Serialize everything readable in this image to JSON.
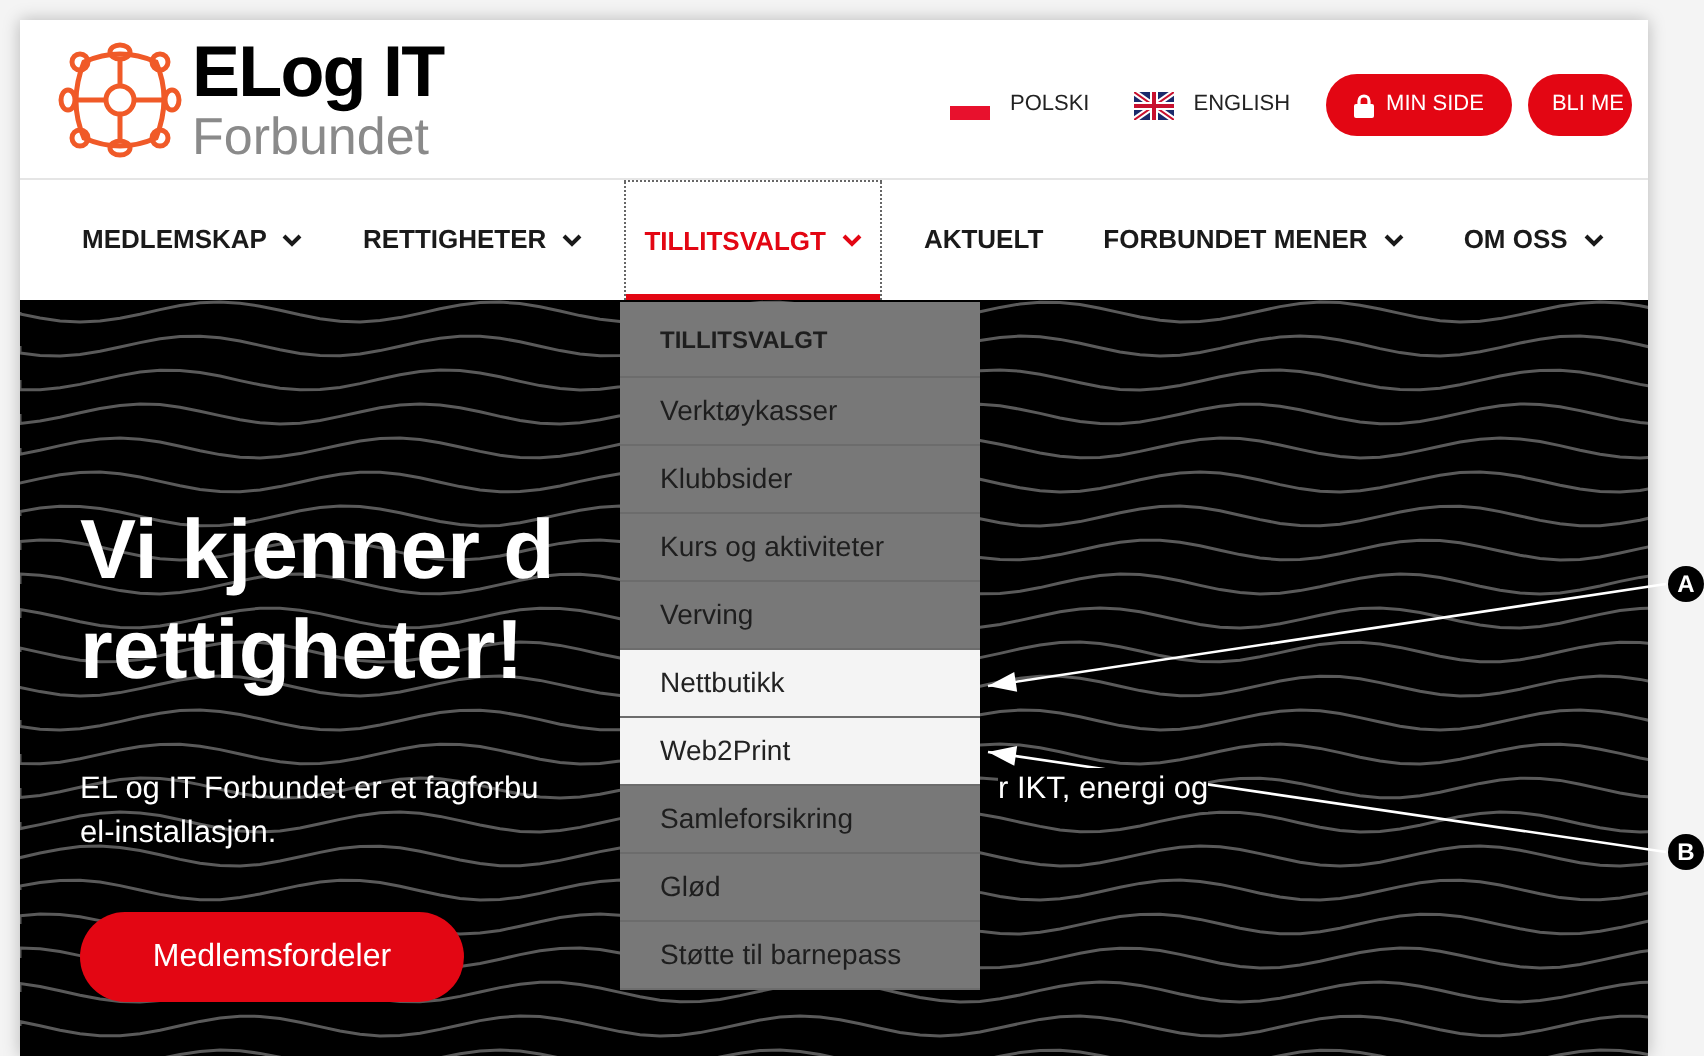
{
  "header": {
    "logo": {
      "title": "ELog IT",
      "subtitle": "Forbundet"
    },
    "languages": [
      {
        "label": "POLSKI"
      },
      {
        "label": "ENGLISH"
      }
    ],
    "buttons": [
      {
        "label": "MIN SIDE"
      },
      {
        "label": "BLI ME"
      }
    ]
  },
  "nav": {
    "items": [
      {
        "label": "MEDLEMSKAP",
        "has_submenu": true,
        "selected": false
      },
      {
        "label": "RETTIGHETER",
        "has_submenu": true,
        "selected": false
      },
      {
        "label": "TILLITSVALGT",
        "has_submenu": true,
        "selected": true
      },
      {
        "label": "AKTUELT",
        "has_submenu": false,
        "selected": false
      },
      {
        "label": "FORBUNDET MENER",
        "has_submenu": true,
        "selected": false
      },
      {
        "label": "OM OSS",
        "has_submenu": true,
        "selected": false
      }
    ]
  },
  "dropdown": {
    "items": [
      {
        "label": "TILLITSVALGT",
        "kind": "heading",
        "highlighted": false
      },
      {
        "label": "Verktøykasser",
        "kind": "link",
        "highlighted": false
      },
      {
        "label": "Klubbsider",
        "kind": "link",
        "highlighted": false
      },
      {
        "label": "Kurs og aktiviteter",
        "kind": "link",
        "highlighted": false
      },
      {
        "label": "Verving",
        "kind": "link",
        "highlighted": false
      },
      {
        "label": "Nettbutikk",
        "kind": "link",
        "highlighted": true
      },
      {
        "label": "Web2Print",
        "kind": "link",
        "highlighted": true
      },
      {
        "label": "Samleforsikring",
        "kind": "link",
        "highlighted": false
      },
      {
        "label": "Glød",
        "kind": "link",
        "highlighted": false
      },
      {
        "label": "Støtte til barnepass",
        "kind": "link",
        "highlighted": false
      }
    ]
  },
  "hero": {
    "heading_lines": [
      "Vi kjenner d",
      "rettigheter!"
    ],
    "paragraph_lines": [
      [
        "EL og IT Forbundet er et fagforbu",
        "r IKT, energi og"
      ],
      [
        "el-installasjon."
      ]
    ],
    "button": "Medlemsfordeler"
  },
  "callouts": [
    {
      "label": "A"
    },
    {
      "label": "B"
    }
  ]
}
